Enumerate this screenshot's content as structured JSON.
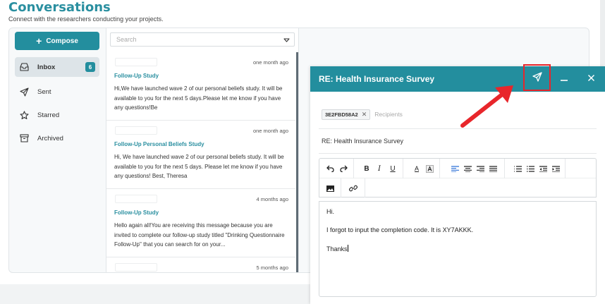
{
  "header": {
    "title": "Conversations",
    "subtitle": "Connect with the researchers conducting your projects."
  },
  "sidebar": {
    "compose_label": "Compose",
    "items": [
      {
        "label": "Inbox",
        "badge": "6",
        "icon": "inbox-icon"
      },
      {
        "label": "Sent",
        "icon": "send-icon"
      },
      {
        "label": "Starred",
        "icon": "star-icon"
      },
      {
        "label": "Archived",
        "icon": "archive-icon"
      }
    ]
  },
  "search": {
    "placeholder": "Search"
  },
  "messages": [
    {
      "time": "one month ago",
      "subject": "Follow-Up Study",
      "body": "Hi,We have launched wave 2 of our personal beliefs study. It will be available to you for the next 5 days.Please let me know if you have any questions!Be"
    },
    {
      "time": "one month ago",
      "subject": "Follow-Up Personal Beliefs Study",
      "body": "Hi, We have launched wave 2 of our personal beliefs study. It will be available to you for the next 5 days. Please let me know if you have any questions! Best, Theresa"
    },
    {
      "time": "4 months ago",
      "subject": "Follow-Up Study",
      "body": "Hello again all!You are receiving this message because you are invited to complete our follow-up study titled \"Drinking Questionnaire Follow-Up\" that you can search for on your..."
    },
    {
      "time": "5 months ago",
      "subject": "",
      "body": ""
    }
  ],
  "compose_modal": {
    "title": "RE: Health Insurance Survey",
    "recipient_chip": "3E2FBD58A2",
    "recipients_placeholder": "Recipients",
    "subject": "RE: Health Insurance Survey",
    "body_lines": [
      "Hi.",
      "I forgot to input the completion code. It is XY7AKKK.",
      "Thanks"
    ]
  },
  "colors": {
    "accent": "#238e9e",
    "title": "#2a8fa0",
    "highlight": "#e8262b"
  }
}
